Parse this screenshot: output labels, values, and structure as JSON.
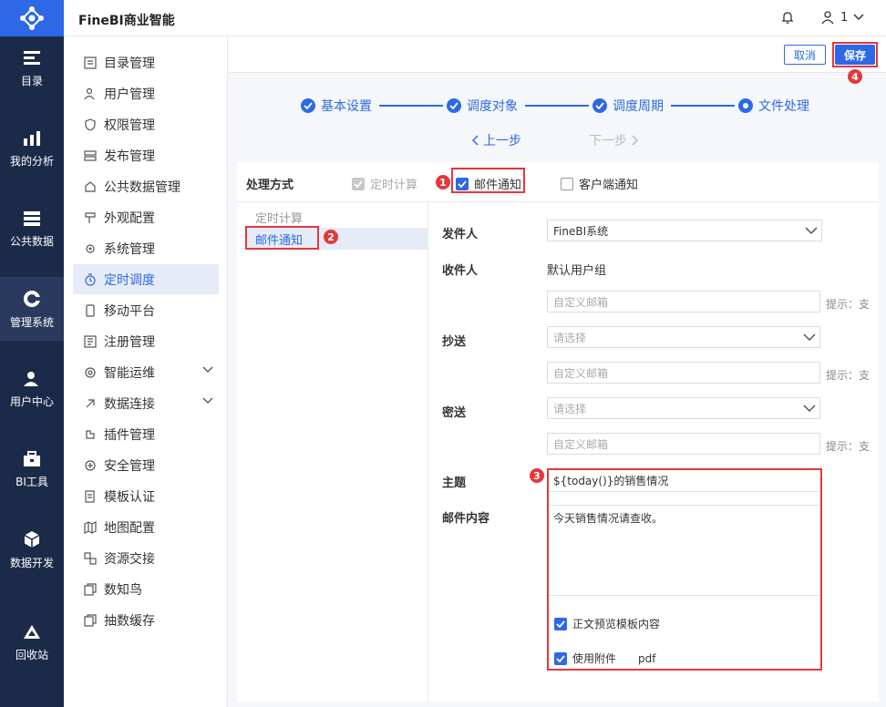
{
  "app": {
    "title": "FineBI商业智能"
  },
  "user": {
    "name": "1"
  },
  "rail": {
    "items": [
      {
        "label": "目录",
        "icon": "catalog-icon"
      },
      {
        "label": "我的分析",
        "icon": "analysis-icon"
      },
      {
        "label": "公共数据",
        "icon": "data-icon"
      },
      {
        "label": "管理系统",
        "icon": "gear-icon"
      },
      {
        "label": "用户中心",
        "icon": "user-center-icon"
      },
      {
        "label": "BI工具",
        "icon": "toolbox-icon"
      },
      {
        "label": "数据开发",
        "icon": "cube-icon"
      },
      {
        "label": "回收站",
        "icon": "recycle-icon"
      }
    ]
  },
  "menu": {
    "items": [
      {
        "label": "目录管理"
      },
      {
        "label": "用户管理"
      },
      {
        "label": "权限管理"
      },
      {
        "label": "发布管理"
      },
      {
        "label": "公共数据管理"
      },
      {
        "label": "外观配置"
      },
      {
        "label": "系统管理"
      },
      {
        "label": "定时调度"
      },
      {
        "label": "移动平台"
      },
      {
        "label": "注册管理"
      },
      {
        "label": "智能运维"
      },
      {
        "label": "数据连接"
      },
      {
        "label": "插件管理"
      },
      {
        "label": "安全管理"
      },
      {
        "label": "模板认证"
      },
      {
        "label": "地图配置"
      },
      {
        "label": "资源交接"
      },
      {
        "label": "数知鸟"
      },
      {
        "label": "抽数缓存"
      }
    ]
  },
  "actions": {
    "cancel": "取消",
    "save": "保存"
  },
  "steps": [
    {
      "label": "基本设置"
    },
    {
      "label": "调度对象"
    },
    {
      "label": "调度周期"
    },
    {
      "label": "文件处理"
    }
  ],
  "nav": {
    "prev": "上一步",
    "next": "下一步"
  },
  "processing": {
    "label": "处理方式",
    "options": [
      {
        "label": "定时计算",
        "checked": true,
        "disabled": true
      },
      {
        "label": "邮件通知",
        "checked": true,
        "disabled": false
      },
      {
        "label": "客户端通知",
        "checked": false,
        "disabled": false
      }
    ]
  },
  "left_list": [
    {
      "label": "定时计算"
    },
    {
      "label": "邮件通知"
    }
  ],
  "form": {
    "sender": {
      "label": "发件人",
      "value": "FineBI系统"
    },
    "recipient": {
      "label": "收件人",
      "value": "默认用户组",
      "placeholder": "自定义邮箱",
      "hint": "提示：支"
    },
    "cc": {
      "label": "抄送",
      "placeholder": "请选择",
      "custom_placeholder": "自定义邮箱",
      "hint": "提示：支"
    },
    "bcc": {
      "label": "密送",
      "placeholder": "请选择",
      "custom_placeholder": "自定义邮箱",
      "hint": "提示：支"
    },
    "subject": {
      "label": "主题",
      "value": "${today()}的销售情况"
    },
    "body": {
      "label": "邮件内容",
      "value": "今天销售情况请查收。"
    },
    "preview": {
      "label": "正文预览模板内容",
      "checked": true
    },
    "attachment": {
      "label": "使用附件",
      "format": "pdf",
      "checked": true
    }
  },
  "annotations": [
    "1",
    "2",
    "3",
    "4"
  ],
  "colors": {
    "accent": "#2d69e6",
    "rail": "#1c2a4a",
    "highlight": "#e5383b"
  }
}
